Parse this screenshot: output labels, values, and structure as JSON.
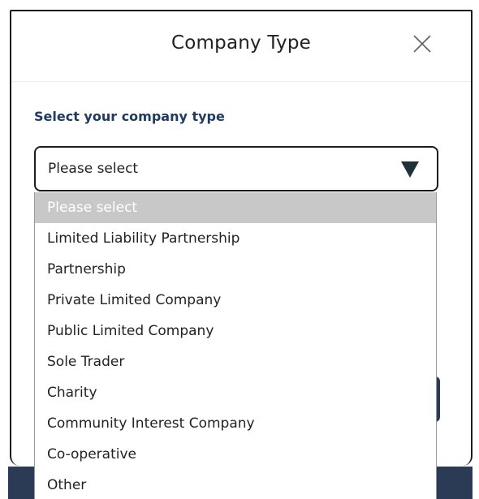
{
  "modal": {
    "title": "Company Type",
    "close_icon": "close-icon"
  },
  "form": {
    "label": "Select your company type",
    "select": {
      "value": "Please select",
      "arrow_icon": "dropdown-arrow-icon"
    }
  },
  "dropdown": {
    "options": [
      "Please select",
      "Limited Liability Partnership",
      "Partnership",
      "Private Limited Company",
      "Public Limited Company",
      "Sole Trader",
      "Charity",
      "Community Interest Company",
      "Co-operative",
      "Other"
    ],
    "highlighted": "Please select"
  },
  "colors": {
    "label": "#1f3b63",
    "highlight": "#c8c8c8",
    "dark": "#2b3a55"
  }
}
